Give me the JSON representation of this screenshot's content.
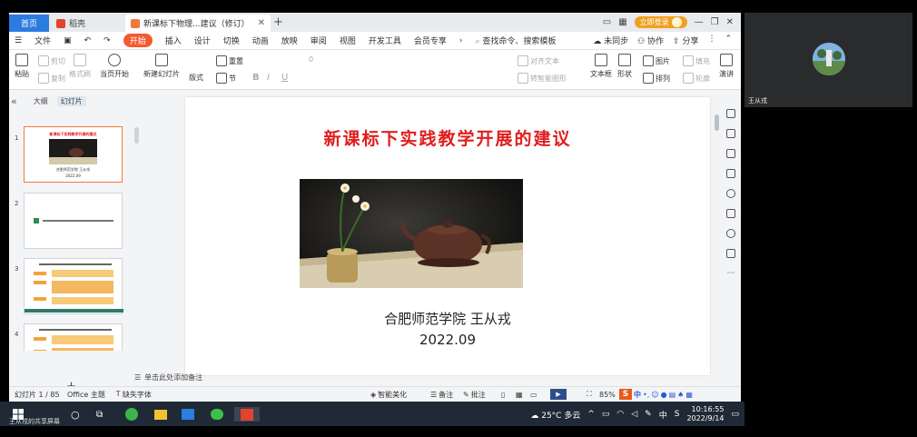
{
  "titlebar": {
    "tabs": [
      {
        "label": "首页"
      },
      {
        "label": "稻壳"
      },
      {
        "label": "新课标下物理...建议（修订）"
      }
    ],
    "login_label": "立即登录"
  },
  "menubar": {
    "file": "文件",
    "items": [
      "开始",
      "插入",
      "设计",
      "切换",
      "动画",
      "放映",
      "审阅",
      "视图",
      "开发工具",
      "会员专享"
    ],
    "search": "查找命令、搜索模板",
    "sync": "未同步",
    "collab": "协作",
    "share": "分享"
  },
  "ribbon": {
    "paste": "粘贴",
    "cut": "剪切",
    "copy": "复制",
    "format_painter": "格式刷",
    "from_current": "当页开始",
    "new_slide": "新建幻灯片",
    "layout": "版式",
    "section": "节",
    "reset": "重置",
    "size_value": "0",
    "text_box": "文本框",
    "shape": "形状",
    "picture": "图片",
    "arrange": "排列",
    "fill": "填充",
    "outline": "轮廓",
    "align_text": "对齐文本",
    "smartart": "转智能图形",
    "play": "演讲"
  },
  "leftpane": {
    "tab_outline": "大纲",
    "tab_slides": "幻灯片",
    "slide_numbers": [
      "1",
      "2",
      "3",
      "4"
    ],
    "thumb1_title": "新课标下实践教学开展的建议",
    "thumb1_author": "合肥师范学院 王从戎",
    "thumb1_date": "2022.09"
  },
  "slide": {
    "title": "新课标下实践教学开展的建议",
    "author": "合肥师范学院    王从戎",
    "date": "2022.09"
  },
  "notes": {
    "placeholder": "单击此处添加备注"
  },
  "statusbar": {
    "slide_count": "幻灯片 1 / 85",
    "theme": "Office 主题",
    "missing_font": "缺失字体",
    "smart_beautify": "智能美化",
    "notes": "备注",
    "comments": "批注",
    "zoom": "85%",
    "ime_lang": "中"
  },
  "camera": {
    "name": "王从戎"
  },
  "taskbar": {
    "share_label": "王从戎的共享屏幕",
    "weather": "25°C 多云",
    "ime": "中",
    "time": "10:16:55",
    "date": "2022/9/14"
  },
  "colors": {
    "accent": "#f45a30",
    "title_red": "#e01e1e",
    "home_blue": "#2b7be0",
    "taskbar": "#1f2a36"
  }
}
